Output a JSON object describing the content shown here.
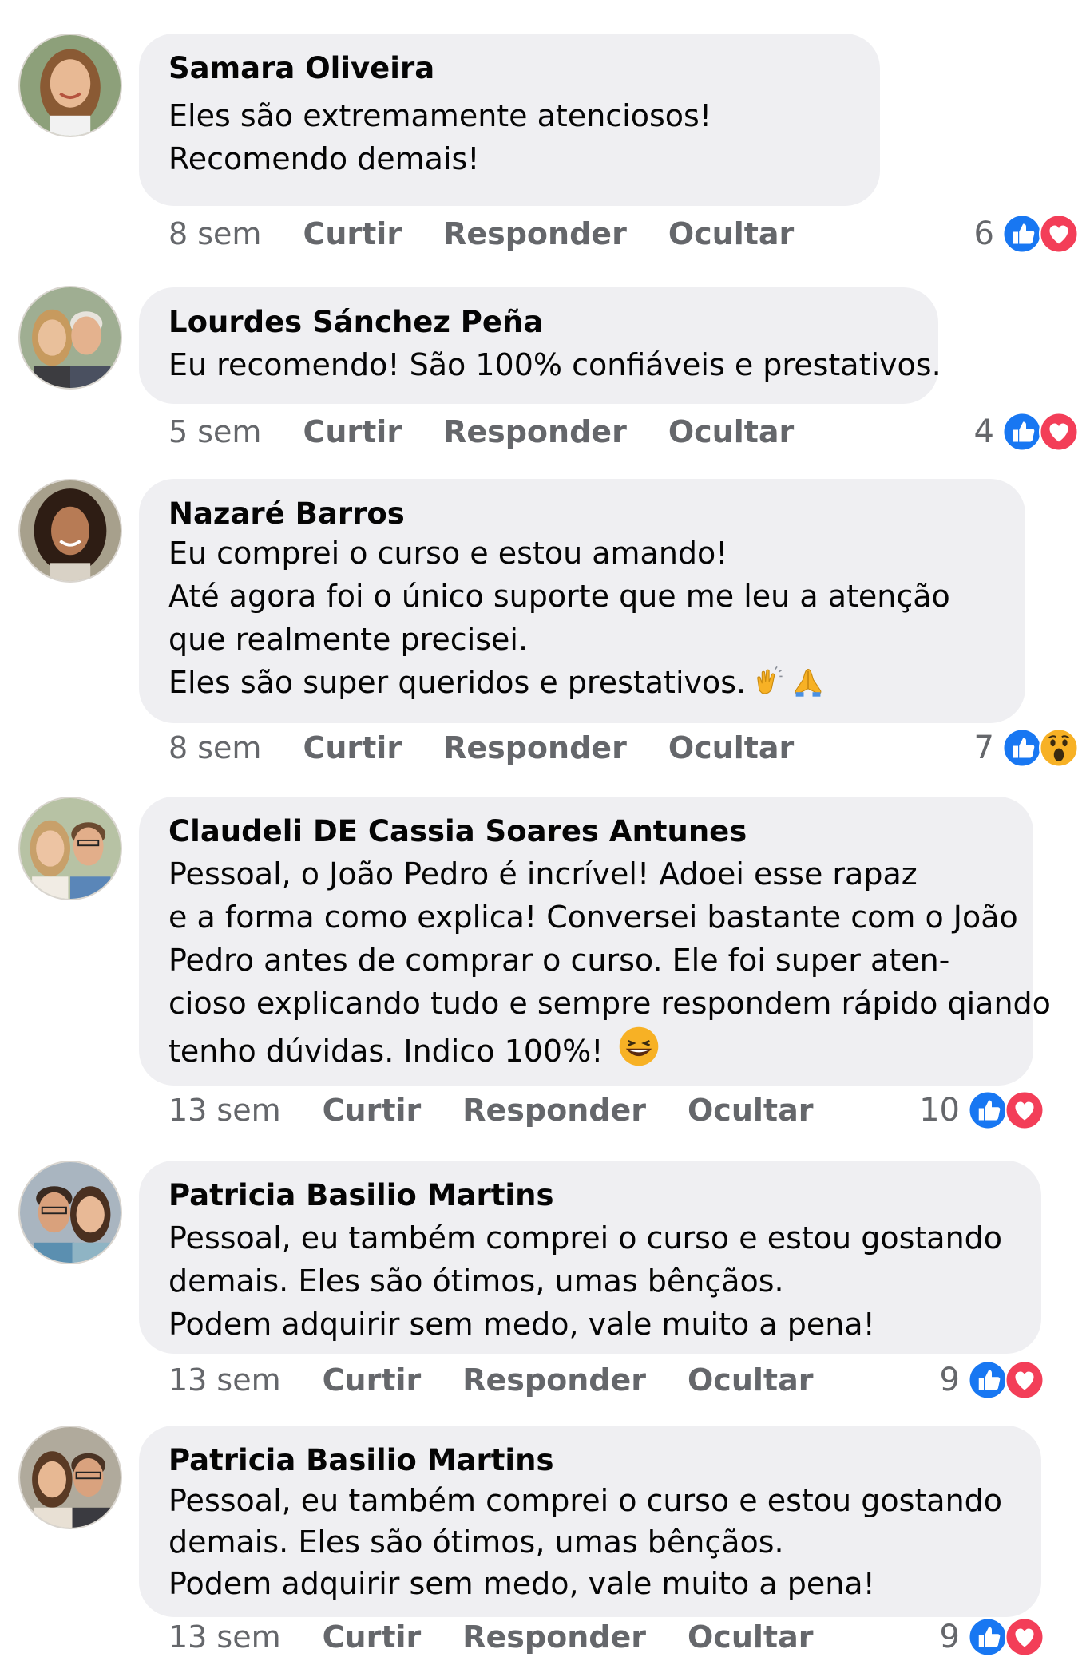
{
  "actions": {
    "like": "Curtir",
    "reply": "Responder",
    "hide": "Ocultar"
  },
  "comments": [
    {
      "author": "Samara Oliveira",
      "lines": [
        "Eles são extremamente atenciosos!",
        "Recomendo demais!"
      ],
      "time": "8 sem",
      "reaction_count": "6",
      "reactions": [
        "like-icon",
        "love-icon"
      ]
    },
    {
      "author": "Lourdes Sánchez Peña",
      "lines": [
        "Eu recomendo! São 100% confiáveis e prestativos."
      ],
      "time": "5 sem",
      "reaction_count": "4",
      "reactions": [
        "like-icon",
        "love-icon"
      ]
    },
    {
      "author": "Nazaré Barros",
      "lines": [
        "Eu comprei o curso e estou amando!",
        "Até agora foi o único suporte que me leu a atenção",
        "que realmente precisei.",
        "Eles são super queridos e prestativos."
      ],
      "time": "8 sem",
      "reaction_count": "7",
      "reactions": [
        "like-icon",
        "wow-icon"
      ]
    },
    {
      "author": "Claudeli DE Cassia Soares Antunes",
      "lines": [
        "Pessoal, o João Pedro é incrível! Adoei esse  rapaz",
        "e a forma como explica! Conversei bastante com o João",
        "Pedro antes de comprar o curso. Ele foi super aten-",
        "cioso explicando tudo e sempre respondem rápido qiando",
        "tenho dúvidas. Indico 100%!"
      ],
      "time": "13 sem",
      "reaction_count": "10",
      "reactions": [
        "like-icon",
        "love-icon"
      ]
    },
    {
      "author": "Patricia Basilio Martins",
      "lines": [
        "Pessoal, eu também comprei o curso e estou gostando",
        "demais. Eles são ótimos, umas bênçãos.",
        "Podem adquirir sem medo, vale muito a pena!"
      ],
      "time": "13 sem",
      "reaction_count": "9",
      "reactions": [
        "like-icon",
        "love-icon"
      ]
    },
    {
      "author": "Patricia Basilio Martins",
      "lines": [
        "Pessoal, eu também comprei o curso e estou gostando",
        "demais. Eles são ótimos, umas bênçãos.",
        "Podem adquirir sem medo, vale muito a pena!"
      ],
      "time": "13 sem",
      "reaction_count": "9",
      "reactions": [
        "like-icon",
        "love-icon"
      ]
    }
  ],
  "colors": {
    "bubble": "#efeff2",
    "meta_text": "#65676b",
    "like_blue": "#1877f2",
    "love_red": "#f33e58",
    "wow_yellow": "#f7b125"
  }
}
